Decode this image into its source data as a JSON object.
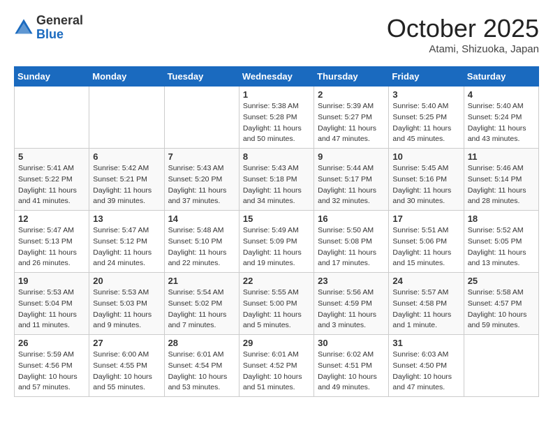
{
  "header": {
    "logo": {
      "general": "General",
      "blue": "Blue"
    },
    "title": "October 2025",
    "location": "Atami, Shizuoka, Japan"
  },
  "calendar": {
    "days_of_week": [
      "Sunday",
      "Monday",
      "Tuesday",
      "Wednesday",
      "Thursday",
      "Friday",
      "Saturday"
    ],
    "weeks": [
      [
        {
          "day": "",
          "sunrise": "",
          "sunset": "",
          "daylight": ""
        },
        {
          "day": "",
          "sunrise": "",
          "sunset": "",
          "daylight": ""
        },
        {
          "day": "",
          "sunrise": "",
          "sunset": "",
          "daylight": ""
        },
        {
          "day": "1",
          "sunrise": "Sunrise: 5:38 AM",
          "sunset": "Sunset: 5:28 PM",
          "daylight": "Daylight: 11 hours and 50 minutes."
        },
        {
          "day": "2",
          "sunrise": "Sunrise: 5:39 AM",
          "sunset": "Sunset: 5:27 PM",
          "daylight": "Daylight: 11 hours and 47 minutes."
        },
        {
          "day": "3",
          "sunrise": "Sunrise: 5:40 AM",
          "sunset": "Sunset: 5:25 PM",
          "daylight": "Daylight: 11 hours and 45 minutes."
        },
        {
          "day": "4",
          "sunrise": "Sunrise: 5:40 AM",
          "sunset": "Sunset: 5:24 PM",
          "daylight": "Daylight: 11 hours and 43 minutes."
        }
      ],
      [
        {
          "day": "5",
          "sunrise": "Sunrise: 5:41 AM",
          "sunset": "Sunset: 5:22 PM",
          "daylight": "Daylight: 11 hours and 41 minutes."
        },
        {
          "day": "6",
          "sunrise": "Sunrise: 5:42 AM",
          "sunset": "Sunset: 5:21 PM",
          "daylight": "Daylight: 11 hours and 39 minutes."
        },
        {
          "day": "7",
          "sunrise": "Sunrise: 5:43 AM",
          "sunset": "Sunset: 5:20 PM",
          "daylight": "Daylight: 11 hours and 37 minutes."
        },
        {
          "day": "8",
          "sunrise": "Sunrise: 5:43 AM",
          "sunset": "Sunset: 5:18 PM",
          "daylight": "Daylight: 11 hours and 34 minutes."
        },
        {
          "day": "9",
          "sunrise": "Sunrise: 5:44 AM",
          "sunset": "Sunset: 5:17 PM",
          "daylight": "Daylight: 11 hours and 32 minutes."
        },
        {
          "day": "10",
          "sunrise": "Sunrise: 5:45 AM",
          "sunset": "Sunset: 5:16 PM",
          "daylight": "Daylight: 11 hours and 30 minutes."
        },
        {
          "day": "11",
          "sunrise": "Sunrise: 5:46 AM",
          "sunset": "Sunset: 5:14 PM",
          "daylight": "Daylight: 11 hours and 28 minutes."
        }
      ],
      [
        {
          "day": "12",
          "sunrise": "Sunrise: 5:47 AM",
          "sunset": "Sunset: 5:13 PM",
          "daylight": "Daylight: 11 hours and 26 minutes."
        },
        {
          "day": "13",
          "sunrise": "Sunrise: 5:47 AM",
          "sunset": "Sunset: 5:12 PM",
          "daylight": "Daylight: 11 hours and 24 minutes."
        },
        {
          "day": "14",
          "sunrise": "Sunrise: 5:48 AM",
          "sunset": "Sunset: 5:10 PM",
          "daylight": "Daylight: 11 hours and 22 minutes."
        },
        {
          "day": "15",
          "sunrise": "Sunrise: 5:49 AM",
          "sunset": "Sunset: 5:09 PM",
          "daylight": "Daylight: 11 hours and 19 minutes."
        },
        {
          "day": "16",
          "sunrise": "Sunrise: 5:50 AM",
          "sunset": "Sunset: 5:08 PM",
          "daylight": "Daylight: 11 hours and 17 minutes."
        },
        {
          "day": "17",
          "sunrise": "Sunrise: 5:51 AM",
          "sunset": "Sunset: 5:06 PM",
          "daylight": "Daylight: 11 hours and 15 minutes."
        },
        {
          "day": "18",
          "sunrise": "Sunrise: 5:52 AM",
          "sunset": "Sunset: 5:05 PM",
          "daylight": "Daylight: 11 hours and 13 minutes."
        }
      ],
      [
        {
          "day": "19",
          "sunrise": "Sunrise: 5:53 AM",
          "sunset": "Sunset: 5:04 PM",
          "daylight": "Daylight: 11 hours and 11 minutes."
        },
        {
          "day": "20",
          "sunrise": "Sunrise: 5:53 AM",
          "sunset": "Sunset: 5:03 PM",
          "daylight": "Daylight: 11 hours and 9 minutes."
        },
        {
          "day": "21",
          "sunrise": "Sunrise: 5:54 AM",
          "sunset": "Sunset: 5:02 PM",
          "daylight": "Daylight: 11 hours and 7 minutes."
        },
        {
          "day": "22",
          "sunrise": "Sunrise: 5:55 AM",
          "sunset": "Sunset: 5:00 PM",
          "daylight": "Daylight: 11 hours and 5 minutes."
        },
        {
          "day": "23",
          "sunrise": "Sunrise: 5:56 AM",
          "sunset": "Sunset: 4:59 PM",
          "daylight": "Daylight: 11 hours and 3 minutes."
        },
        {
          "day": "24",
          "sunrise": "Sunrise: 5:57 AM",
          "sunset": "Sunset: 4:58 PM",
          "daylight": "Daylight: 11 hours and 1 minute."
        },
        {
          "day": "25",
          "sunrise": "Sunrise: 5:58 AM",
          "sunset": "Sunset: 4:57 PM",
          "daylight": "Daylight: 10 hours and 59 minutes."
        }
      ],
      [
        {
          "day": "26",
          "sunrise": "Sunrise: 5:59 AM",
          "sunset": "Sunset: 4:56 PM",
          "daylight": "Daylight: 10 hours and 57 minutes."
        },
        {
          "day": "27",
          "sunrise": "Sunrise: 6:00 AM",
          "sunset": "Sunset: 4:55 PM",
          "daylight": "Daylight: 10 hours and 55 minutes."
        },
        {
          "day": "28",
          "sunrise": "Sunrise: 6:01 AM",
          "sunset": "Sunset: 4:54 PM",
          "daylight": "Daylight: 10 hours and 53 minutes."
        },
        {
          "day": "29",
          "sunrise": "Sunrise: 6:01 AM",
          "sunset": "Sunset: 4:52 PM",
          "daylight": "Daylight: 10 hours and 51 minutes."
        },
        {
          "day": "30",
          "sunrise": "Sunrise: 6:02 AM",
          "sunset": "Sunset: 4:51 PM",
          "daylight": "Daylight: 10 hours and 49 minutes."
        },
        {
          "day": "31",
          "sunrise": "Sunrise: 6:03 AM",
          "sunset": "Sunset: 4:50 PM",
          "daylight": "Daylight: 10 hours and 47 minutes."
        },
        {
          "day": "",
          "sunrise": "",
          "sunset": "",
          "daylight": ""
        }
      ]
    ]
  }
}
